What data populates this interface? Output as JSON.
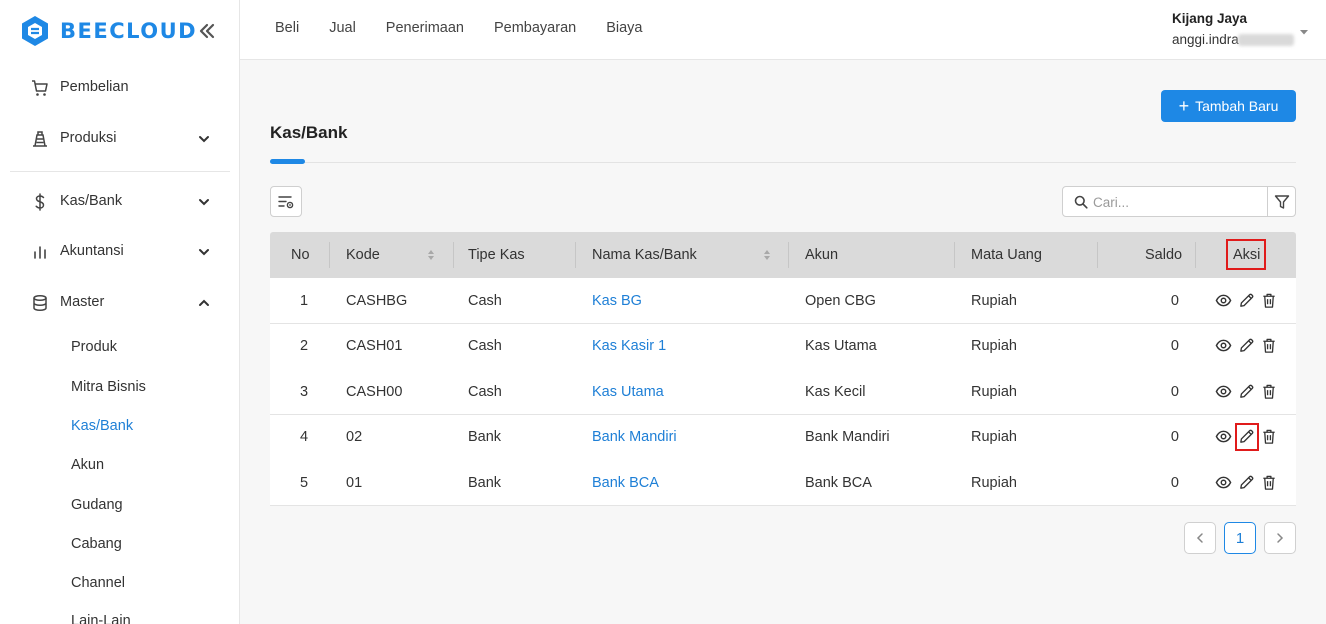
{
  "brand": {
    "name": "BEECLOUD"
  },
  "sidebar": {
    "items": [
      {
        "label": "Pembelian",
        "icon": "cart-icon"
      },
      {
        "label": "Produksi",
        "icon": "factory-icon",
        "expanded": false
      },
      {
        "label": "Kas/Bank",
        "icon": "dollar-icon",
        "expanded": false
      },
      {
        "label": "Akuntansi",
        "icon": "bar-chart-icon",
        "expanded": false
      },
      {
        "label": "Master",
        "icon": "database-icon",
        "expanded": true
      }
    ],
    "master_sub": [
      "Produk",
      "Mitra Bisnis",
      "Kas/Bank",
      "Akun",
      "Gudang",
      "Cabang",
      "Channel",
      "Lain-Lain"
    ],
    "active_sub": "Kas/Bank"
  },
  "topnav": [
    "Beli",
    "Jual",
    "Penerimaan",
    "Pembayaran",
    "Biaya"
  ],
  "user": {
    "company": "Kijang Jaya",
    "email": "anggi.indra"
  },
  "page": {
    "title": "Kas/Bank",
    "add_button": "Tambah Baru",
    "search_placeholder": "Cari..."
  },
  "table": {
    "columns": [
      "No",
      "Kode",
      "Tipe Kas",
      "Nama Kas/Bank",
      "Akun",
      "Mata Uang",
      "Saldo",
      "Aksi"
    ],
    "rows": [
      {
        "no": "1",
        "kode": "CASHBG",
        "tipe": "Cash",
        "nama": "Kas BG",
        "akun": "Open CBG",
        "mata_uang": "Rupiah",
        "saldo": "0"
      },
      {
        "no": "2",
        "kode": "CASH01",
        "tipe": "Cash",
        "nama": "Kas Kasir 1",
        "akun": "Kas Utama",
        "mata_uang": "Rupiah",
        "saldo": "0"
      },
      {
        "no": "3",
        "kode": "CASH00",
        "tipe": "Cash",
        "nama": "Kas Utama",
        "akun": "Kas Kecil",
        "mata_uang": "Rupiah",
        "saldo": "0"
      },
      {
        "no": "4",
        "kode": "02",
        "tipe": "Bank",
        "nama": "Bank Mandiri",
        "akun": "Bank Mandiri",
        "mata_uang": "Rupiah",
        "saldo": "0"
      },
      {
        "no": "5",
        "kode": "01",
        "tipe": "Bank",
        "nama": "Bank BCA",
        "akun": "Bank BCA",
        "mata_uang": "Rupiah",
        "saldo": "0"
      }
    ]
  },
  "pagination": {
    "current": "1",
    "prev_icon": "chevron-left-icon",
    "next_icon": "chevron-right-icon"
  },
  "colors": {
    "primary": "#1e88e5",
    "link": "#1e7fd6",
    "highlight": "#e01b1b",
    "header_bg": "#dadada"
  }
}
